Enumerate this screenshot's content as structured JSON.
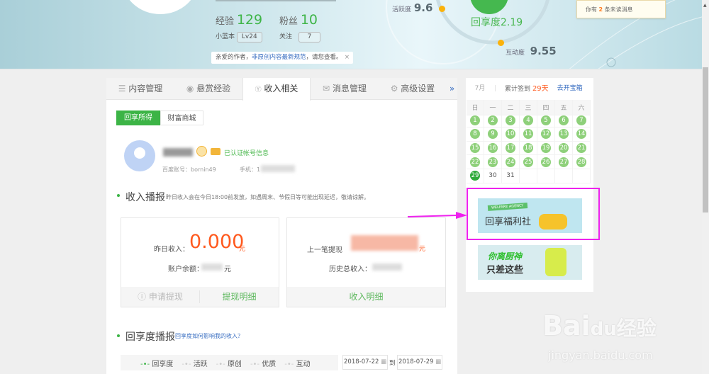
{
  "header": {
    "stats": {
      "exp_label": "经验",
      "exp_value": "129",
      "fans_label": "粉丝",
      "fans_value": "10",
      "level_label": "小蓝本",
      "level_value": "Lv24",
      "follow_label": "关注",
      "follow_value": "7"
    },
    "notice": {
      "prefix": "亲爱的作者，",
      "link": "非原创内容最新规范",
      "suffix": "，请您查看。",
      "close": "×"
    },
    "scores": {
      "activity_label": "活跃度",
      "activity_value": "9.6",
      "share_label": "回享度",
      "share_value": "2.19",
      "interact_label": "互动度",
      "interact_value": "9.55"
    },
    "message": {
      "prefix": "你有",
      "count": "2",
      "suffix": "条未读消息"
    }
  },
  "tabs": [
    {
      "label": "内容管理",
      "icon": "list-icon"
    },
    {
      "label": "悬赏经验",
      "icon": "coin-icon"
    },
    {
      "label": "收入相关",
      "icon": "yen-icon",
      "active": true
    },
    {
      "label": "消息管理",
      "icon": "mail-icon"
    },
    {
      "label": "高级设置",
      "icon": "gear-icon"
    }
  ],
  "tabs_more": "»",
  "subtabs": [
    "回享所得",
    "财富商城"
  ],
  "profile": {
    "verified": "已认证帐号信息",
    "account_label": "百度账号：bornin49",
    "phone_label": "手机：1"
  },
  "income": {
    "title": "收入播报",
    "note": "昨日收入会在今日18:00前发放，如遇周末、节假日等可能出现延迟，敬请谅解。",
    "yesterday_label": "昨日收入：",
    "yesterday_value": "0.000",
    "unit": "元",
    "balance_label": "账户余额：",
    "balance_unit": "元",
    "last_withdraw_label": "上一笔提现",
    "last_unit": "元",
    "total_label": "历史总收入：",
    "apply_withdraw": "申请提现",
    "withdraw_detail": "提现明细",
    "income_detail": "收入明细"
  },
  "share": {
    "title": "回享度播报",
    "link": "回享度如何影响我的收入？",
    "legend": [
      "回享度",
      "活跃",
      "原创",
      "优质",
      "互动"
    ],
    "date_from": "2018-07-22",
    "date_sep": "到",
    "date_to": "2018-07-29"
  },
  "calendar": {
    "month": "7月",
    "sign_prefix": "累计签到",
    "sign_days": "29天",
    "open_box": "去开宝箱",
    "weekdays": [
      "日",
      "一",
      "二",
      "三",
      "四",
      "五",
      "六"
    ],
    "days_signed": 29,
    "today": 29,
    "last_day": 31
  },
  "banners": {
    "welfare": "回享福利社",
    "welfare_sub": "WELFARE AGENCY",
    "chef_line1": "你离厨神",
    "chef_line2": "只差这些"
  },
  "watermark": {
    "logo": "Bai经验",
    "url": "jingyan.baidu.com"
  },
  "colors": {
    "green": "#3fb548",
    "orange": "#ff5a1f",
    "link": "#3a6fc2",
    "highlight": "#ee22ee"
  }
}
